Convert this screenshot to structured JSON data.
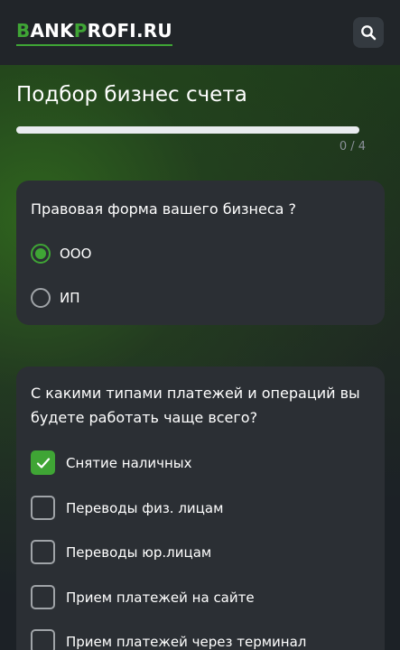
{
  "header": {
    "logo_text_parts": [
      "B",
      "ANK",
      "P",
      "ROFI.RU"
    ],
    "search_icon": "search-icon"
  },
  "page": {
    "title": "Подбор бизнес счета",
    "progress": {
      "current": 0,
      "total": 4,
      "label": "0 / 4",
      "fraction": 0
    }
  },
  "questions": [
    {
      "text": "Правовая форма вашего бизнеса ?",
      "type": "radio",
      "options": [
        {
          "label": "ООО",
          "selected": true
        },
        {
          "label": "ИП",
          "selected": false
        }
      ]
    },
    {
      "text": "С какими типами платежей и операций вы будете работать чаще всего?",
      "type": "checkbox",
      "options": [
        {
          "label": "Снятие наличных",
          "checked": true
        },
        {
          "label": "Переводы физ. лицам",
          "checked": false
        },
        {
          "label": "Переводы юр.лицам",
          "checked": false
        },
        {
          "label": "Прием платежей на сайте",
          "checked": false
        },
        {
          "label": "Прием платежей через терминал",
          "checked": false
        }
      ]
    }
  ],
  "colors": {
    "accent": "#3fa535",
    "header_bg": "#212529",
    "card_bg": "#2b2f34",
    "muted_text": "#8a9099"
  }
}
